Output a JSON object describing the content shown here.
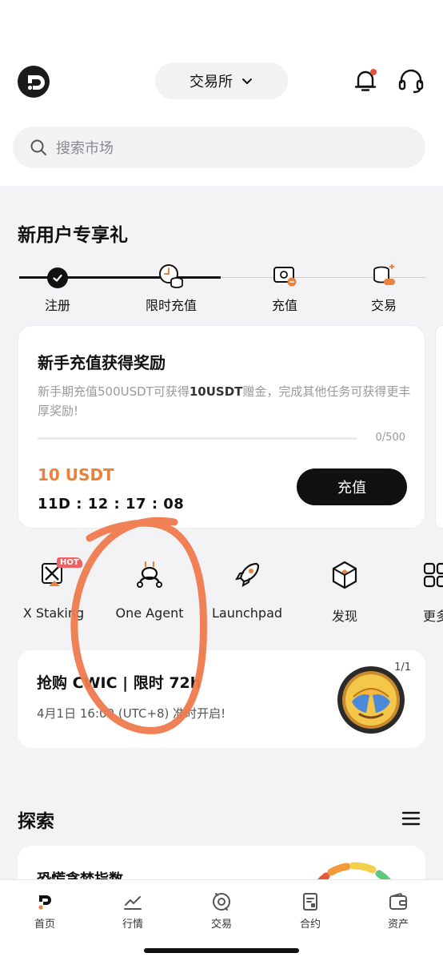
{
  "header": {
    "exchange_label": "交易所",
    "search_placeholder": "搜索市场"
  },
  "newbie": {
    "title": "新用户专享礼",
    "steps": [
      {
        "label": "注册",
        "done": true
      },
      {
        "label": "限时充值",
        "done": true
      },
      {
        "label": "充值",
        "done": false
      },
      {
        "label": "交易",
        "done": false
      }
    ]
  },
  "reward_card": {
    "title": "新手充值获得奖励",
    "desc_prefix": "新手期充值500USDT可获得",
    "desc_bold": "10USDT",
    "desc_suffix": "赠金，完成其他任务可获得更丰厚奖励!",
    "progress_text": "0/500",
    "progress_fraction": 0,
    "reward": "10 USDT",
    "countdown": "11D : 12 : 17 : 08",
    "button": "充值"
  },
  "quick_actions": [
    {
      "label": "X Staking",
      "icon": "x-staking-icon",
      "badge": "HOT"
    },
    {
      "label": "One Agent",
      "icon": "robot-agent-icon"
    },
    {
      "label": "Launchpad",
      "icon": "rocket-icon"
    },
    {
      "label": "发现",
      "icon": "cube-discover-icon"
    },
    {
      "label": "更多",
      "icon": "grid-more-icon"
    }
  ],
  "banner": {
    "title": "抢购 CWIC | 限时 72h",
    "subtitle": "4月1日 16:00 (UTC+8) 准时开启!",
    "pager": "1/1"
  },
  "explore": {
    "title": "探索",
    "fear_greed_title": "恐慌贪婪指数"
  },
  "tabbar": [
    {
      "label": "首页",
      "icon": "home-icon",
      "active": true
    },
    {
      "label": "行情",
      "icon": "market-chart-icon"
    },
    {
      "label": "交易",
      "icon": "trade-icon"
    },
    {
      "label": "合约",
      "icon": "contract-icon"
    },
    {
      "label": "资产",
      "icon": "wallet-icon"
    }
  ],
  "colors": {
    "accent": "#e8823d",
    "annotation": "#ef7a4e",
    "primary_dark": "#111111",
    "hot_badge": "#f06262"
  }
}
